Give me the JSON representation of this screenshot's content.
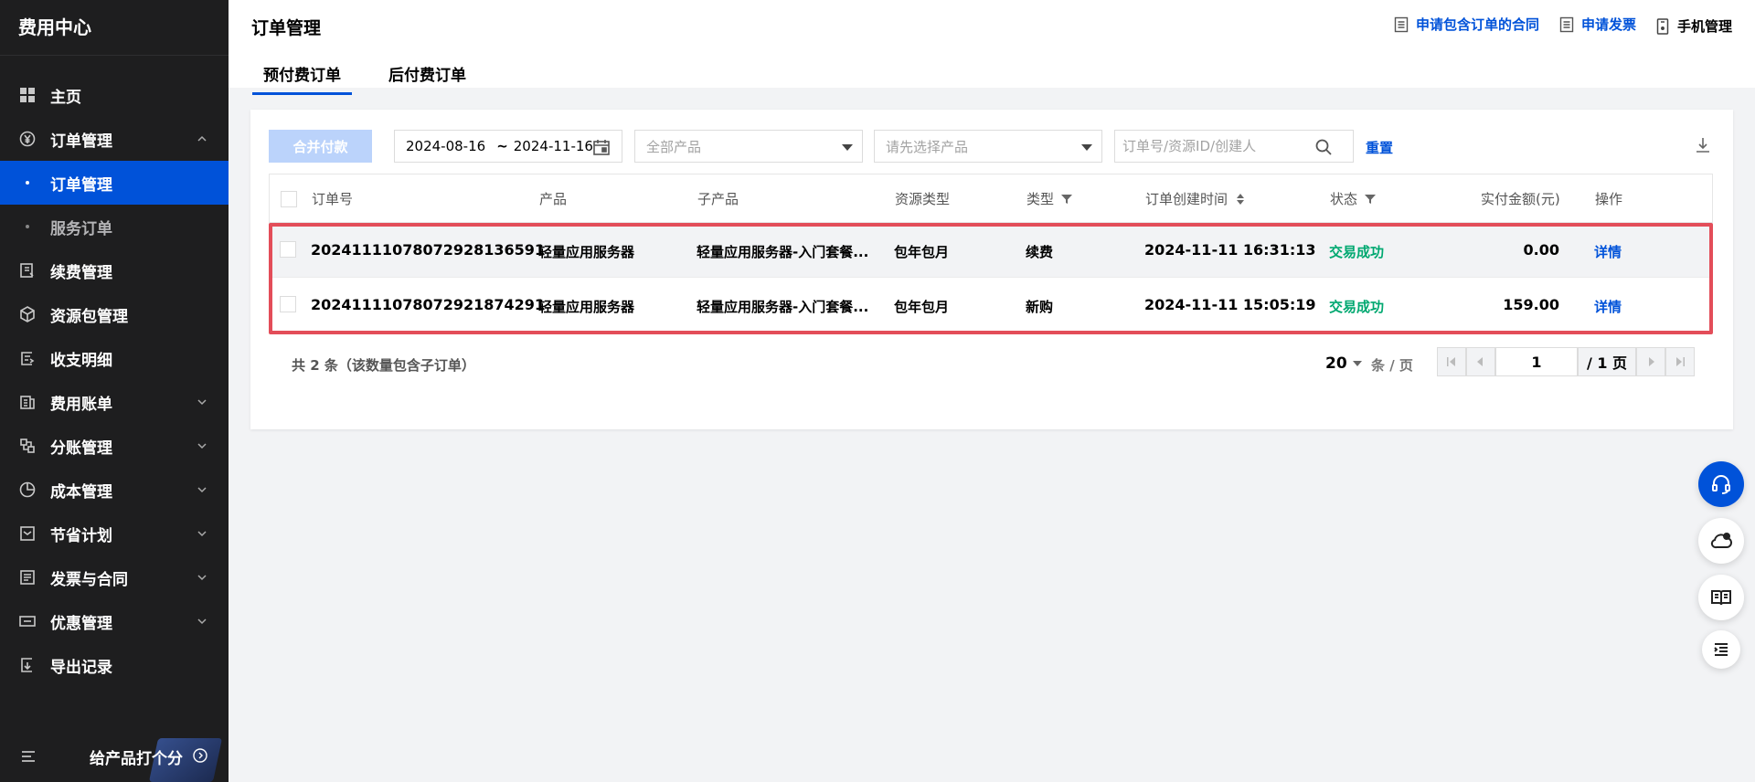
{
  "sidebar": {
    "title": "费用中心",
    "items": [
      {
        "label": "主页",
        "icon": "grid-icon"
      },
      {
        "label": "订单管理",
        "icon": "yen-circle-icon",
        "expanded": true
      },
      {
        "label": "续费管理",
        "icon": "renew-icon"
      },
      {
        "label": "资源包管理",
        "icon": "package-icon"
      },
      {
        "label": "收支明细",
        "icon": "ledger-icon"
      },
      {
        "label": "费用账单",
        "icon": "bill-icon"
      },
      {
        "label": "分账管理",
        "icon": "split-icon"
      },
      {
        "label": "成本管理",
        "icon": "pie-icon"
      },
      {
        "label": "节省计划",
        "icon": "plan-icon"
      },
      {
        "label": "发票与合同",
        "icon": "invoice-icon"
      },
      {
        "label": "优惠管理",
        "icon": "coupon-icon"
      },
      {
        "label": "导出记录",
        "icon": "export-icon"
      }
    ],
    "subitems": [
      {
        "label": "订单管理",
        "active": true
      },
      {
        "label": "服务订单",
        "active": false
      }
    ],
    "rate_label": "给产品打个分"
  },
  "header": {
    "title": "订单管理",
    "tabs": [
      {
        "label": "预付费订单",
        "active": true
      },
      {
        "label": "后付费订单",
        "active": false
      }
    ],
    "links": {
      "contract": "申请包含订单的合同",
      "invoice": "申请发票",
      "mobile": "手机管理"
    }
  },
  "toolbar": {
    "merge_pay": "合并付款",
    "date_start": "2024-08-16",
    "date_sep": "~",
    "date_end": "2024-11-16",
    "product_placeholder": "全部产品",
    "subproduct_placeholder": "请先选择产品",
    "search_placeholder": "订单号/资源ID/创建人",
    "reset": "重置"
  },
  "table": {
    "columns": [
      "订单号",
      "产品",
      "子产品",
      "资源类型",
      "类型",
      "订单创建时间",
      "状态",
      "实付金额(元)",
      "操作"
    ],
    "rows": [
      {
        "order_id": "20241111078072928136591",
        "product": "轻量应用服务器",
        "subproduct": "轻量应用服务器-入门套餐...",
        "resource_type": "包年包月",
        "type": "续费",
        "created": "2024-11-11 16:31:13",
        "status": "交易成功",
        "amount": "0.00",
        "action": "详情"
      },
      {
        "order_id": "20241111078072921874291",
        "product": "轻量应用服务器",
        "subproduct": "轻量应用服务器-入门套餐...",
        "resource_type": "包年包月",
        "type": "新购",
        "created": "2024-11-11 15:05:19",
        "status": "交易成功",
        "amount": "159.00",
        "action": "详情"
      }
    ]
  },
  "footer": {
    "total": "共 2 条（该数量包含子订单）",
    "page_size": "20",
    "page_unit": "条 / 页",
    "current_page": "1",
    "total_pages": "/ 1 页"
  },
  "colors": {
    "sidebar_bg": "#1e1e1f",
    "brand": "#0052d9",
    "success": "#00a870",
    "highlight": "#e34d59"
  }
}
